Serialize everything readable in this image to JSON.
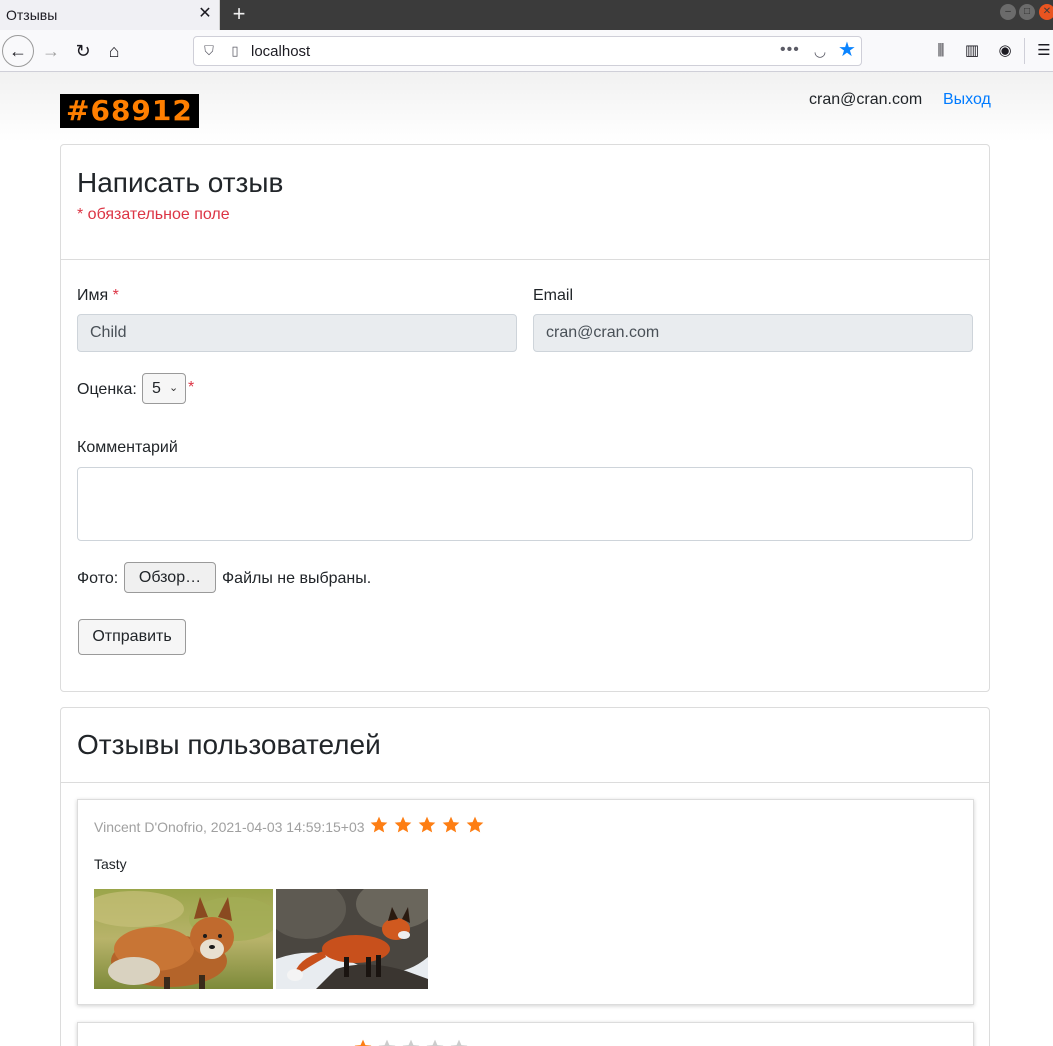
{
  "browser": {
    "tab_title": "Отзывы",
    "tab_close": "✕",
    "new_tab": "+",
    "url": "localhost"
  },
  "header": {
    "logo_text": "#68912",
    "user_email": "cran@cran.com",
    "logout_label": "Выход"
  },
  "form": {
    "title": "Написать отзыв",
    "required_note": "* обязательное поле",
    "name_label": "Имя",
    "name_value": "Child",
    "email_label": "Email",
    "email_value": "cran@cran.com",
    "rating_label": "Оценка:",
    "rating_value": "5",
    "required_mark": "*",
    "comment_label": "Комментарий",
    "comment_value": "",
    "photo_label": "Фото:",
    "browse_label": "Обзор…",
    "file_status": "Файлы не выбраны.",
    "submit_label": "Отправить"
  },
  "reviews": {
    "title": "Отзывы пользователей",
    "items": [
      {
        "meta": "Vincent D'Onofrio, 2021-04-03 14:59:15+03",
        "rating": 5,
        "text": "Tasty",
        "photos": [
          "fox-photo-1",
          "fox-photo-2"
        ]
      },
      {
        "meta": "",
        "rating": 1
      }
    ]
  },
  "colors": {
    "accent": "#007bff",
    "required": "#dc3545",
    "star_filled": "#fd7e14",
    "star_empty": "#cccccc",
    "logo_bg": "#000000",
    "logo_fg": "#ff7f00"
  },
  "icons": {
    "back": "back-arrow-icon",
    "forward": "forward-arrow-icon",
    "reload": "reload-icon",
    "home": "home-icon",
    "shield": "shield-icon",
    "page": "page-icon",
    "more": "more-icon",
    "pocket": "pocket-icon",
    "bookmark": "star-icon",
    "library": "library-icon",
    "sidebar": "sidebar-icon",
    "account": "account-icon",
    "menu": "menu-icon"
  }
}
